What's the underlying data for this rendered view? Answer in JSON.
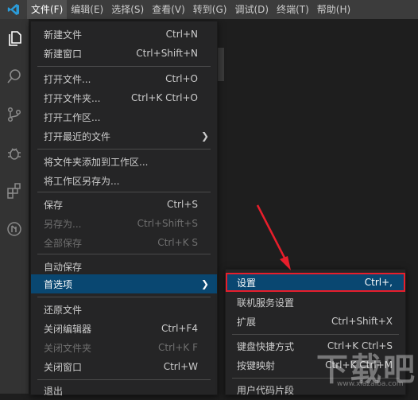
{
  "menubar": {
    "items": [
      "文件(F)",
      "编辑(E)",
      "选择(S)",
      "查看(V)",
      "转到(G)",
      "调试(D)",
      "终端(T)",
      "帮助(H)"
    ],
    "active_index": 0
  },
  "activitybar": {
    "icons": [
      "files-icon",
      "search-icon",
      "source-control-icon",
      "debug-icon",
      "extensions-icon",
      "remote-icon"
    ]
  },
  "file_menu": {
    "items": [
      {
        "label": "新建文件",
        "shortcut": "Ctrl+N"
      },
      {
        "label": "新建窗口",
        "shortcut": "Ctrl+Shift+N"
      },
      {
        "label": "打开文件...",
        "shortcut": "Ctrl+O"
      },
      {
        "label": "打开文件夹...",
        "shortcut": "Ctrl+K Ctrl+O"
      },
      {
        "label": "打开工作区...",
        "shortcut": ""
      },
      {
        "label": "打开最近的文件",
        "shortcut": ""
      },
      {
        "label": "将文件夹添加到工作区...",
        "shortcut": ""
      },
      {
        "label": "将工作区另存为...",
        "shortcut": ""
      },
      {
        "label": "保存",
        "shortcut": "Ctrl+S"
      },
      {
        "label": "另存为...",
        "shortcut": "Ctrl+Shift+S"
      },
      {
        "label": "全部保存",
        "shortcut": "Ctrl+K S"
      },
      {
        "label": "自动保存",
        "shortcut": ""
      },
      {
        "label": "首选项",
        "shortcut": ""
      },
      {
        "label": "还原文件",
        "shortcut": ""
      },
      {
        "label": "关闭编辑器",
        "shortcut": "Ctrl+F4"
      },
      {
        "label": "关闭文件夹",
        "shortcut": "Ctrl+K F"
      },
      {
        "label": "关闭窗口",
        "shortcut": "Ctrl+W"
      },
      {
        "label": "退出",
        "shortcut": ""
      }
    ]
  },
  "preferences_submenu": {
    "items": [
      {
        "label": "设置",
        "shortcut": "Ctrl+,"
      },
      {
        "label": "联机服务设置",
        "shortcut": ""
      },
      {
        "label": "扩展",
        "shortcut": "Ctrl+Shift+X"
      },
      {
        "label": "键盘快捷方式",
        "shortcut": "Ctrl+K Ctrl+S"
      },
      {
        "label": "按键映射",
        "shortcut": "Ctrl+K Ctrl+M"
      },
      {
        "label": "用户代码片段",
        "shortcut": ""
      }
    ]
  },
  "colors": {
    "accent_blue": "#094771",
    "highlight_red": "#e81e2b",
    "menubar_bg": "#3c3c3c",
    "menu_bg": "#252526"
  },
  "watermark": {
    "big": "下载吧",
    "small": "www.xiazaiba.com"
  }
}
